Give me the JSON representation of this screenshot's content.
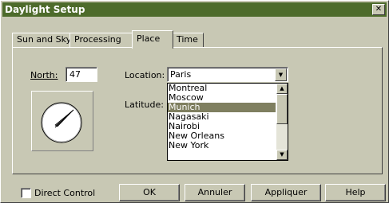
{
  "window": {
    "title": "Daylight Setup",
    "close_glyph": "✕"
  },
  "tabs": [
    {
      "label": "Sun and Sky"
    },
    {
      "label": "Processing"
    },
    {
      "label": "Place"
    },
    {
      "label": "Time"
    }
  ],
  "place": {
    "north_label": "North:",
    "north_value": "47",
    "location_label": "Location:",
    "location_value": "Paris",
    "latitude_label": "Latitude:",
    "location_options": [
      "Montreal",
      "Moscow",
      "Munich",
      "Nagasaki",
      "Nairobi",
      "New Orleans",
      "New York"
    ],
    "selected_option": "Munich"
  },
  "footer": {
    "direct_control_label": "Direct Control",
    "direct_control_checked": false,
    "ok_label": "OK",
    "cancel_label": "Annuler",
    "apply_label": "Appliquer",
    "help_label": "Help"
  },
  "colors": {
    "titlebar": "#4d6b2b",
    "face": "#c8c8b4",
    "selection": "#7f7f60"
  },
  "icons": {
    "close": "close-icon",
    "compass": "compass-dial-icon",
    "dropdown": "chevron-down-icon",
    "scroll_up": "scroll-up-icon",
    "scroll_down": "scroll-down-icon"
  }
}
